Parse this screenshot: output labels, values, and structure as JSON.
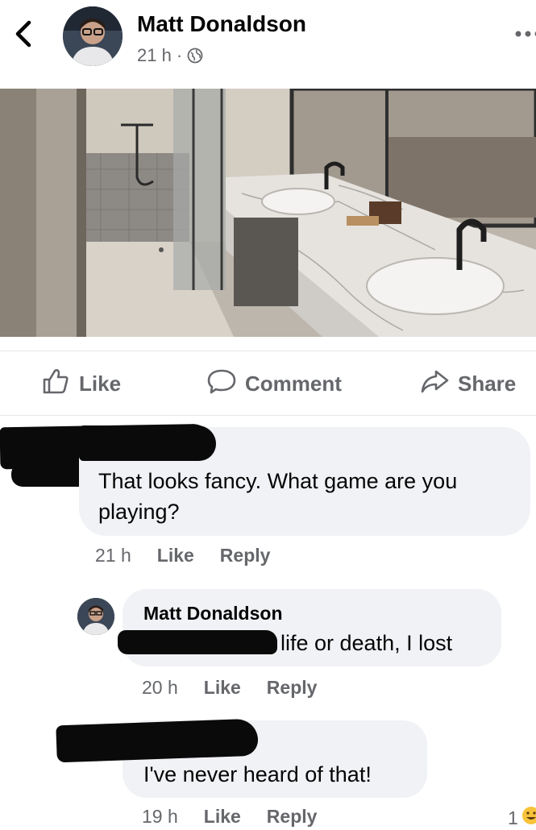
{
  "post": {
    "author": "Matt Donaldson",
    "time": "21 h",
    "separator": "·",
    "privacy_icon": "globe-icon"
  },
  "actions": {
    "like": "Like",
    "comment": "Comment",
    "share": "Share"
  },
  "comments": [
    {
      "text": "That looks fancy. What game are you playing?",
      "time": "21 h",
      "like": "Like",
      "reply": "Reply"
    },
    {
      "author": "Matt Donaldson",
      "text": "life or death, I lost",
      "time": "20 h",
      "like": "Like",
      "reply": "Reply"
    },
    {
      "text": "I've never heard of that!",
      "time": "19 h",
      "like": "Like",
      "reply": "Reply",
      "reaction_count": "1"
    }
  ],
  "colors": {
    "text": "#050505",
    "muted": "#65676b",
    "bubble": "#f0f2f5",
    "divider": "#e4e6eb"
  }
}
